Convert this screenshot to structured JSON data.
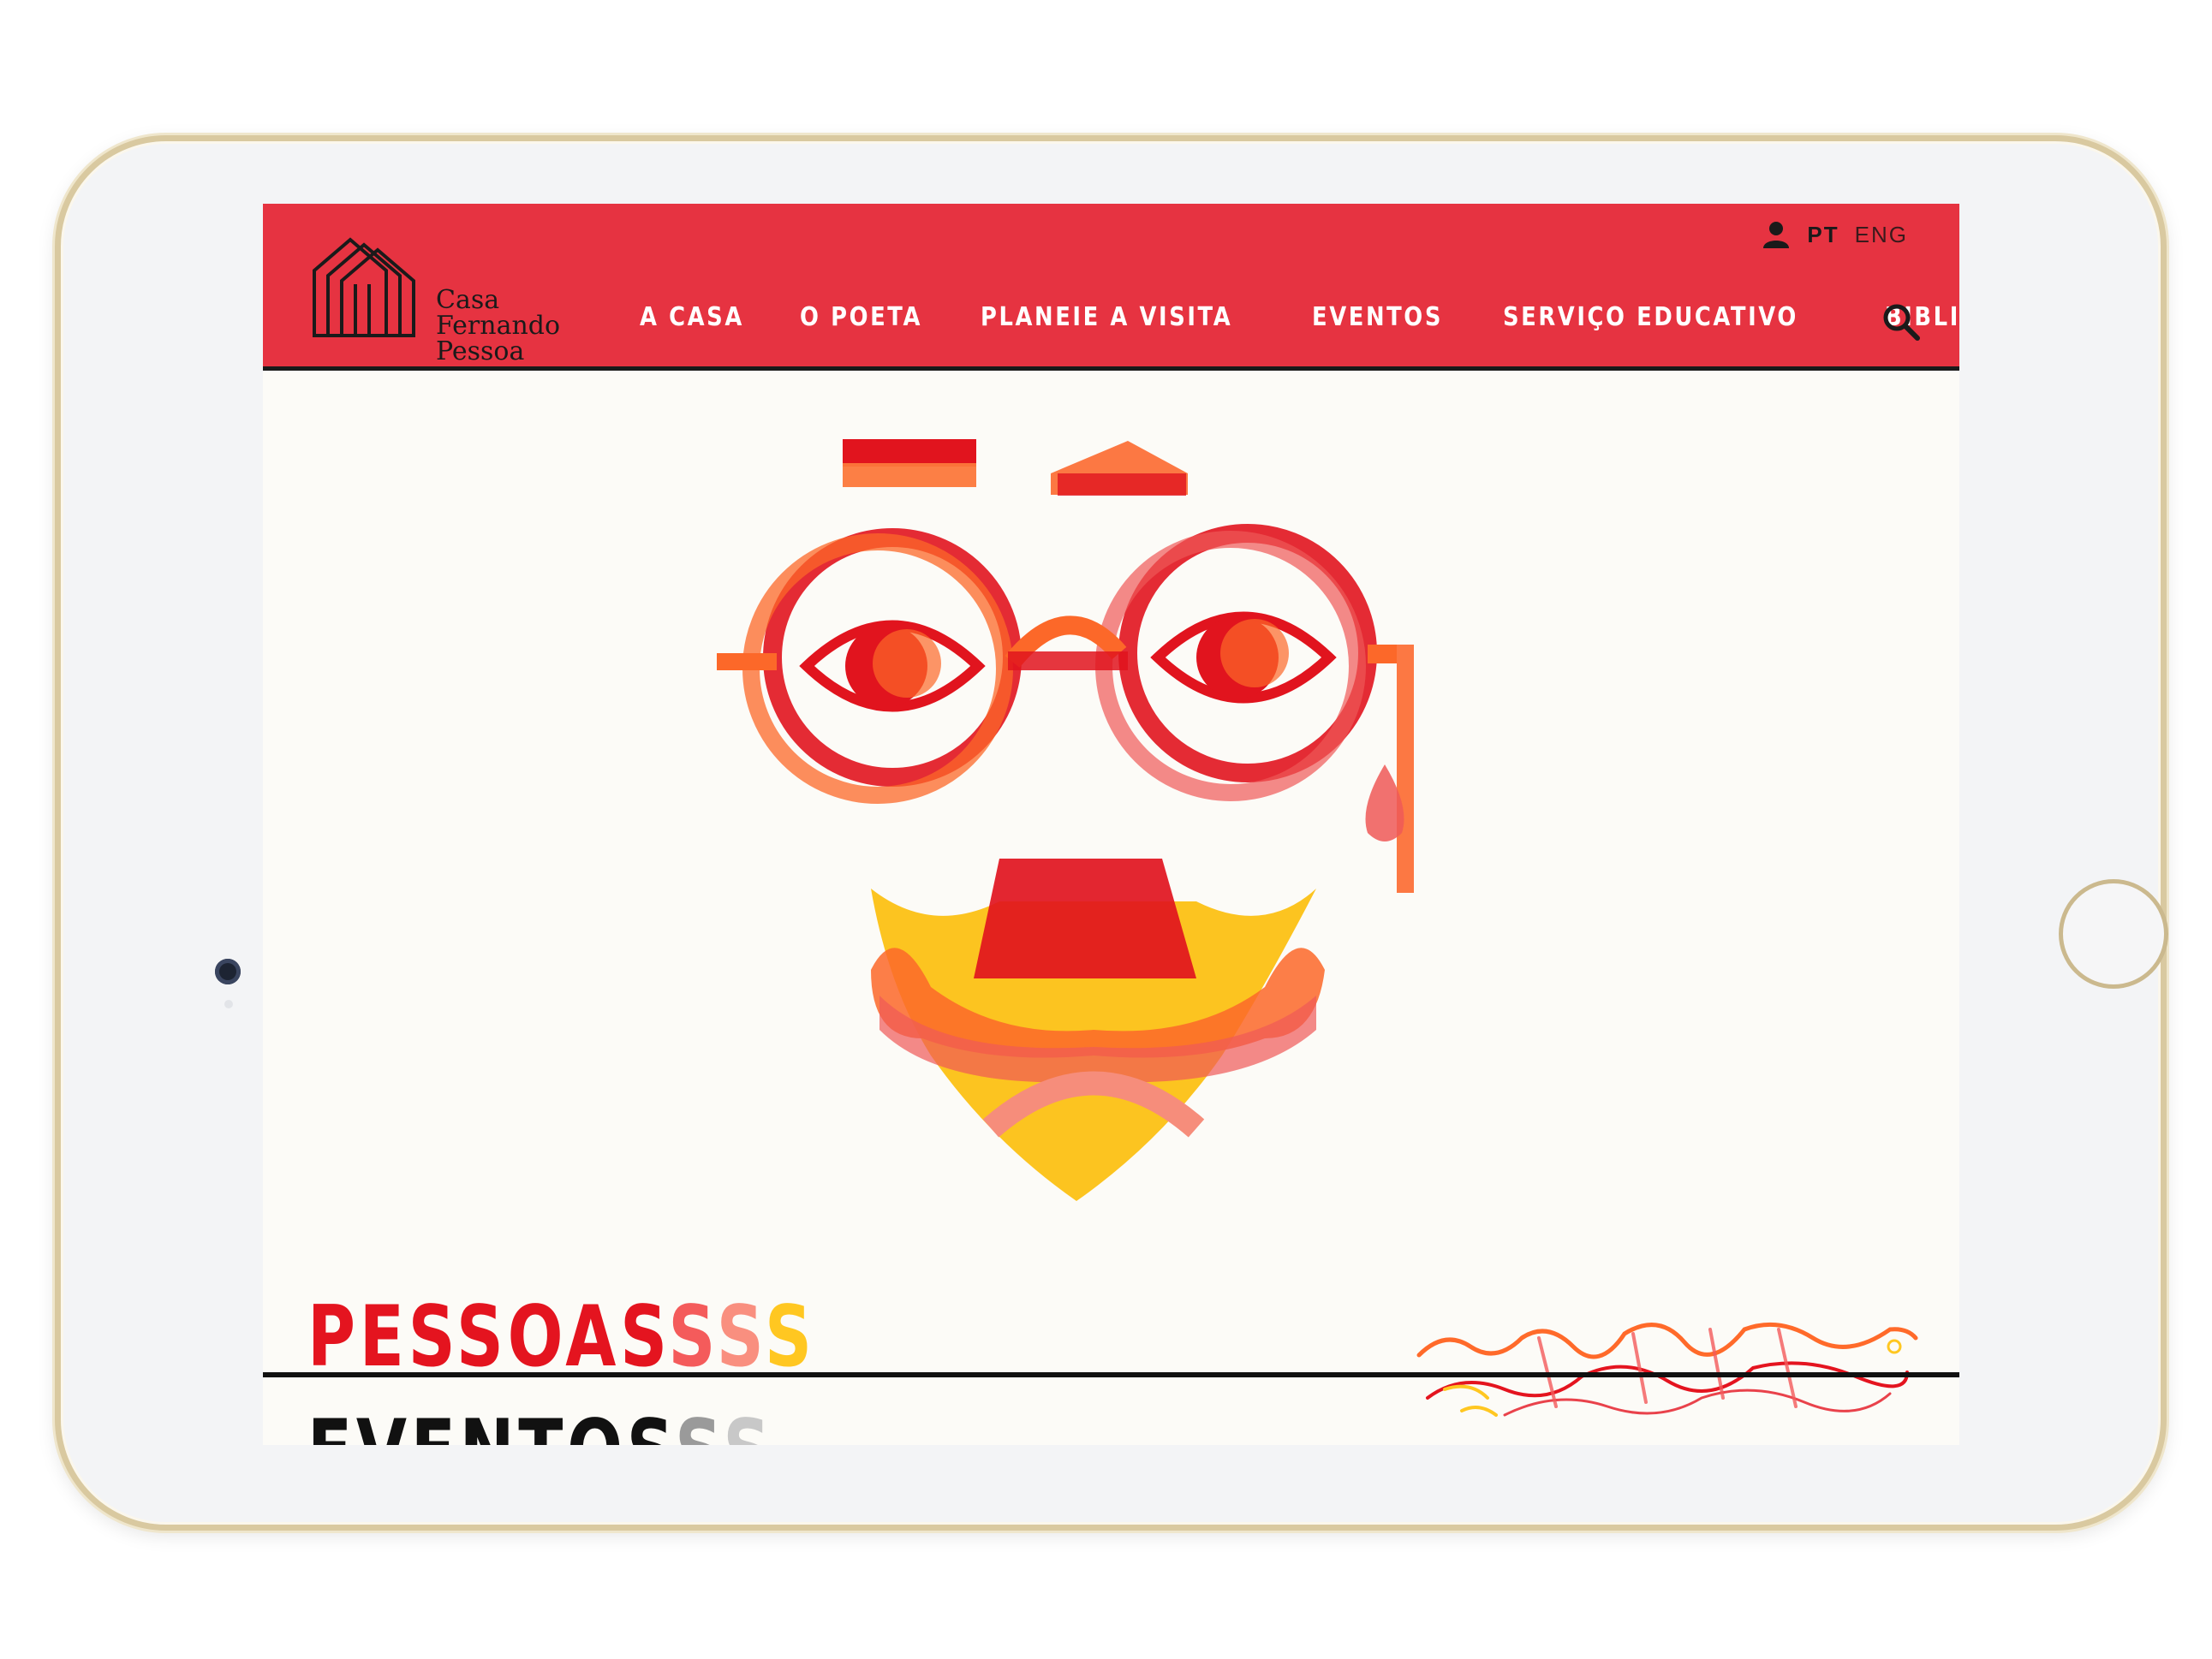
{
  "site": {
    "logo_lines": [
      "Casa",
      "Fernando",
      "Pessoa"
    ]
  },
  "header": {
    "account_icon": "user-icon",
    "languages": {
      "active": "PT",
      "inactive": "ENG"
    },
    "nav": [
      {
        "label": "A CASA"
      },
      {
        "label": "O POETA"
      },
      {
        "label": "PLANEIE A VISITA"
      },
      {
        "label": "EVENTOS"
      },
      {
        "label": "SERVIÇO EDUCATIVO"
      },
      {
        "label": "BIBLIOTECA ONLINE"
      }
    ],
    "search_icon": "search-icon"
  },
  "hero": {
    "title_main": "PESSOAS",
    "title_echo": [
      "S",
      "S",
      "S"
    ],
    "illustration": "pessoa-face-illustration",
    "signature": "pessoa-signature"
  },
  "next_section": {
    "title_main": "EVENTOS",
    "title_echo": [
      "S",
      "S"
    ]
  },
  "colors": {
    "header_bg": "#e63341",
    "accent_red": "#e4141f",
    "accent_yellow": "#ffc721",
    "page_bg": "#fcfbf7"
  }
}
